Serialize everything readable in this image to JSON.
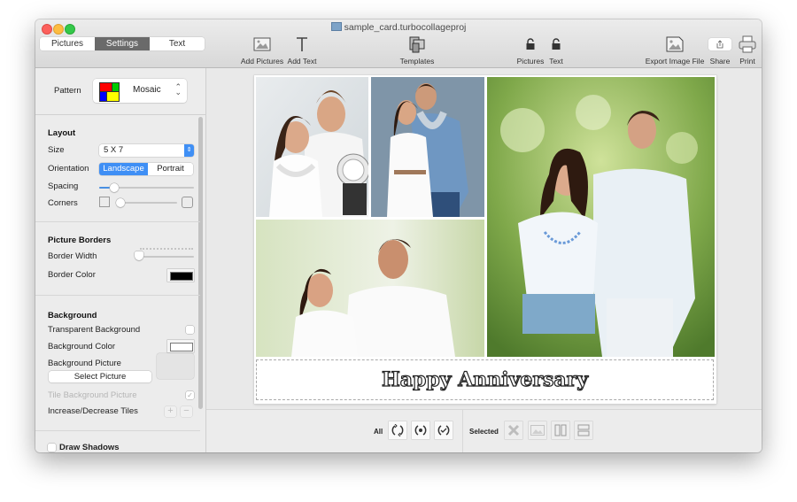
{
  "window": {
    "title": "sample_card.turbocollageproj"
  },
  "tabs": [
    {
      "label": "Pictures",
      "active": false
    },
    {
      "label": "Settings",
      "active": true
    },
    {
      "label": "Text",
      "active": false
    }
  ],
  "toolbar": {
    "add_pictures": "Add Pictures",
    "add_text": "Add Text",
    "templates": "Templates",
    "lock_pictures": "Pictures",
    "lock_text": "Text",
    "export": "Export Image File",
    "share": "Share",
    "print": "Print"
  },
  "sidebar": {
    "pattern_label": "Pattern",
    "pattern_value": "Mosaic",
    "pattern_colors": [
      "#ff0000",
      "#00cc00",
      "#0000ff",
      "#ffff00"
    ],
    "layout": {
      "title": "Layout",
      "size_label": "Size",
      "size_value": "5 X 7",
      "orientation_label": "Orientation",
      "orientation_options": [
        "Landscape",
        "Portrait"
      ],
      "orientation_selected": "Landscape",
      "spacing_label": "Spacing",
      "spacing_value_fraction": 0.15,
      "corners_label": "Corners",
      "corners_value_fraction": 0.05
    },
    "borders": {
      "title": "Picture Borders",
      "width_label": "Border Width",
      "width_value_fraction": 0.0,
      "color_label": "Border Color",
      "color_value": "#000000"
    },
    "background": {
      "title": "Background",
      "transparent_label": "Transparent Background",
      "transparent_checked": false,
      "color_label": "Background Color",
      "color_value": "#ffffff",
      "picture_label": "Background Picture",
      "select_picture_button": "Select Picture",
      "tile_label": "Tile Background Picture",
      "tile_checked": true,
      "tiles_label": "Increase/Decrease Tiles",
      "plus": "+",
      "minus": "−"
    },
    "shadows": {
      "label": "Draw Shadows",
      "checked": false
    }
  },
  "canvas": {
    "caption": "Happy Anniversary",
    "photos": [
      {
        "name": "couple-fitness",
        "desc": "Couple with bathroom scale"
      },
      {
        "name": "couple-blue-wall",
        "desc": "Couple against blue wall"
      },
      {
        "name": "couple-outdoor-smiling",
        "desc": "Couple smiling outdoors"
      },
      {
        "name": "couple-park-walk",
        "desc": "Couple walking in park"
      }
    ]
  },
  "bottom_bar": {
    "all_label": "All",
    "selected_label": "Selected"
  }
}
